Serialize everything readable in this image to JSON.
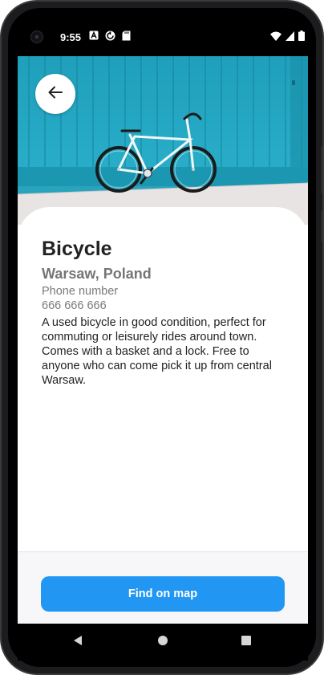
{
  "status_bar": {
    "time": "9:55",
    "left_icons": [
      "a-notification-icon",
      "sync-notification-icon",
      "sd-card-icon"
    ],
    "right_icons": [
      "wifi-icon",
      "cell-signal-icon",
      "battery-icon"
    ]
  },
  "hero": {
    "image_subject": "bicycle-photo",
    "back_icon": "arrow-left-icon"
  },
  "item": {
    "title": "Bicycle",
    "location": "Warsaw, Poland",
    "phone_label": "Phone number",
    "phone_number": "666 666 666",
    "description": "A used bicycle in good condition, perfect for commuting or leisurely rides around town. Comes with a basket and a lock. Free to anyone who can come pick it up from central Warsaw."
  },
  "actions": {
    "find_on_map_label": "Find on map"
  },
  "nav": {
    "icons": [
      "nav-back-icon",
      "nav-home-icon",
      "nav-recents-icon"
    ]
  },
  "colors": {
    "accent": "#2196f3",
    "title_text": "#222222",
    "secondary_text": "#757575",
    "hero_wall": "#23a9c4"
  }
}
